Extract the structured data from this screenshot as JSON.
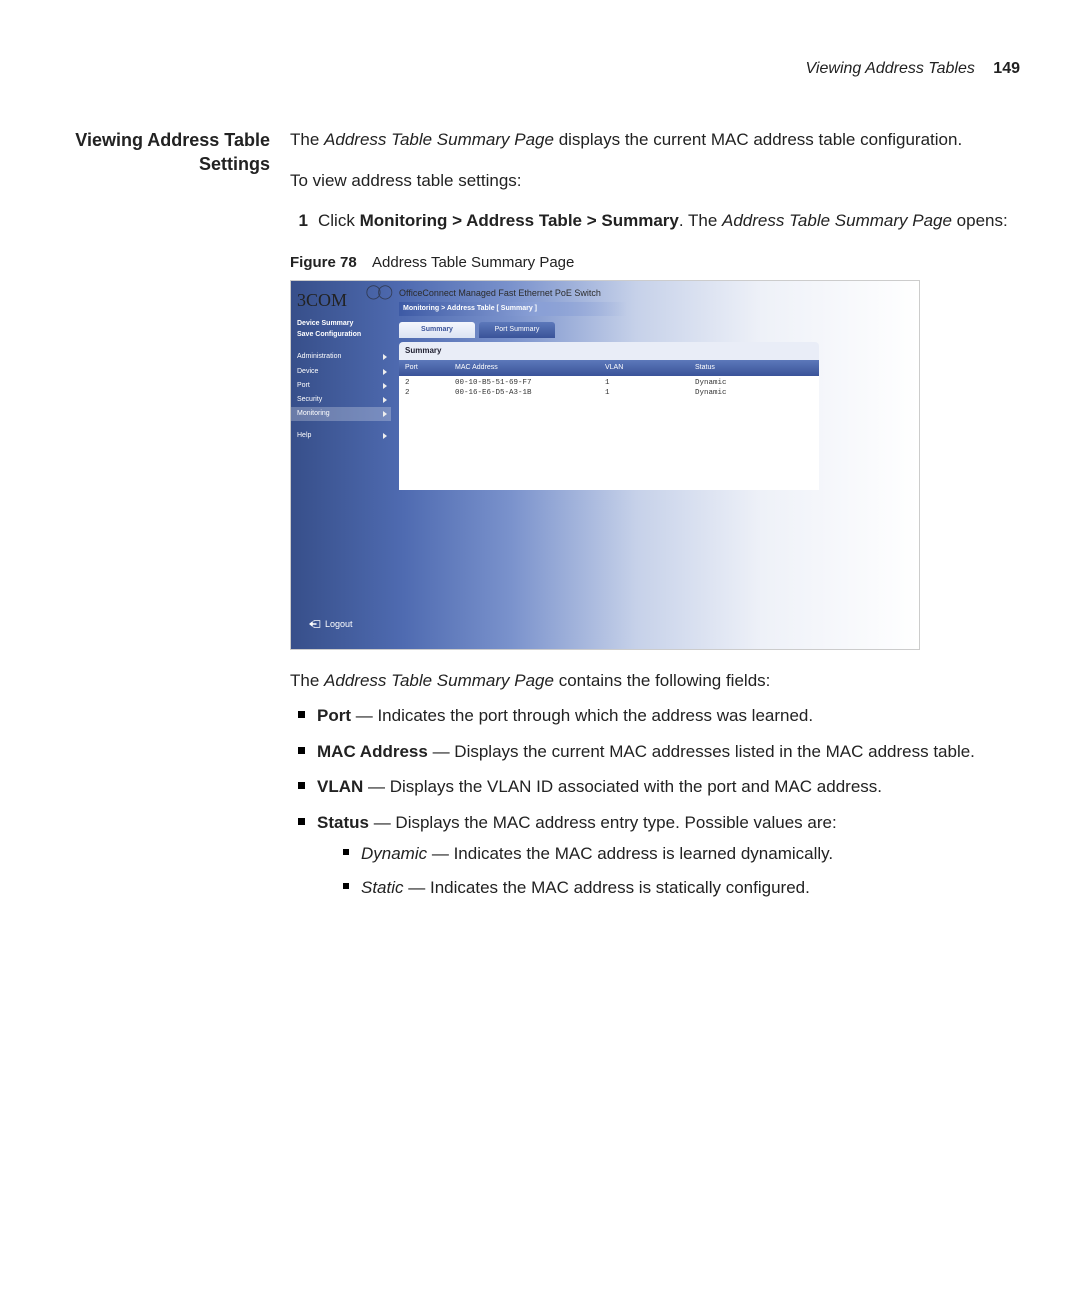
{
  "header": {
    "title": "Viewing Address Tables",
    "page": "149"
  },
  "sideHeading": "Viewing Address Table Settings",
  "intro": {
    "sentence_prefix": "The ",
    "page_name": "Address Table Summary Page",
    "sentence_suffix": " displays the current MAC address table configuration.",
    "lead_in": "To view address table settings:"
  },
  "step": {
    "num": "1",
    "click": "Click ",
    "path": "Monitoring > Address Table > Summary",
    "after_path": ". The ",
    "page_name": "Address Table Summary Page",
    "opens": " opens:"
  },
  "figure": {
    "label": "Figure 78",
    "caption": "Address Table Summary Page"
  },
  "screenshot": {
    "brand": "3COM",
    "product": "OfficeConnect Managed Fast Ethernet PoE Switch",
    "breadcrumb": "Monitoring > Address Table [ Summary ]",
    "sidebarLinks": [
      "Device Summary",
      "Save Configuration"
    ],
    "menu": [
      "Administration",
      "Device",
      "Port",
      "Security",
      "Monitoring"
    ],
    "menuActive": "Monitoring",
    "help": "Help",
    "logout": "Logout",
    "tabs": [
      "Summary",
      "Port Summary"
    ],
    "activeTab": "Summary",
    "panelTitle": "Summary",
    "columns": [
      "Port",
      "MAC Address",
      "VLAN",
      "Status"
    ],
    "rows": [
      {
        "port": "2",
        "mac": "00-10-B5-51-69-F7",
        "vlan": "1",
        "status": "Dynamic"
      },
      {
        "port": "2",
        "mac": "00-16-E6-D5-A3-1B",
        "vlan": "1",
        "status": "Dynamic"
      }
    ]
  },
  "postFigure": {
    "lead_prefix": "The ",
    "page_name": "Address Table Summary Page",
    "lead_suffix": " contains the following fields:",
    "fields": [
      {
        "name": "Port",
        "desc": " — Indicates the port through which the address was learned."
      },
      {
        "name": "MAC Address",
        "desc": " — Displays the current MAC addresses listed in the MAC address table."
      },
      {
        "name": "VLAN",
        "desc": " — Displays the VLAN ID associated with the port and MAC address."
      },
      {
        "name": "Status",
        "desc": " — Displays the MAC address entry type. Possible values are:"
      }
    ],
    "statusValues": [
      {
        "name": "Dynamic",
        "desc": " — Indicates the MAC address is learned dynamically."
      },
      {
        "name": "Static",
        "desc": " — Indicates the MAC address is statically configured."
      }
    ]
  }
}
